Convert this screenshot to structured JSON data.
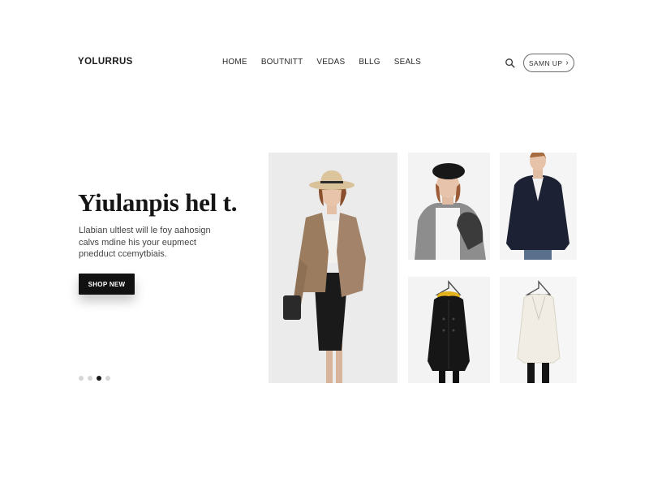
{
  "brand": {
    "logo": "YOLURRUS"
  },
  "nav": {
    "items": [
      {
        "label": "HOME"
      },
      {
        "label": "BOUTNITT"
      },
      {
        "label": "VEDAS"
      },
      {
        "label": "BLLG"
      },
      {
        "label": "SEALS"
      }
    ]
  },
  "header": {
    "search_icon": "search-icon",
    "signup_label": "SAMN UP",
    "signup_icon": "chevron-right-icon"
  },
  "hero": {
    "title": "Yiulanpis hel t.",
    "description_lines": [
      "Llabian ultlest will le foy aahosign",
      "calvs mdine his your eupmect",
      "pnedduct ccemytbiais."
    ],
    "cta_label": "SHOP NEW",
    "carousel": {
      "count": 4,
      "active_index": 2
    }
  },
  "products": [
    {
      "name": "woman-in-hat-and-tan-blazer",
      "icon": "fashion-photo"
    },
    {
      "name": "woman-in-beret-and-grey-cardigan",
      "icon": "fashion-photo"
    },
    {
      "name": "woman-in-navy-blazer",
      "icon": "fashion-photo"
    },
    {
      "name": "black-hooded-coat-on-hanger",
      "icon": "coat-photo"
    },
    {
      "name": "cream-jacket-on-hanger",
      "icon": "coat-photo"
    }
  ]
}
